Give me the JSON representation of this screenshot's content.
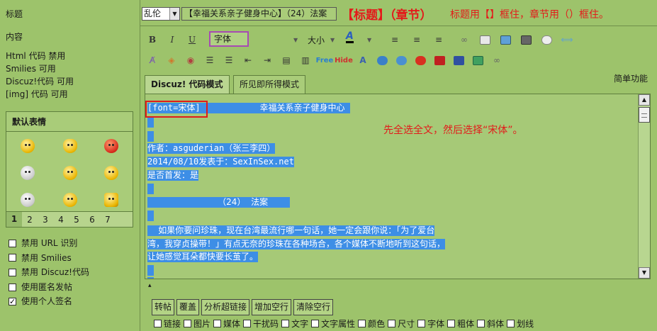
{
  "left": {
    "title_label": "标题",
    "content_label": "内容",
    "rules": [
      "Html 代码 禁用",
      "Smilies 可用",
      "Discuz!代码 可用",
      "[img] 代码 可用"
    ],
    "smilies_title": "默认表情",
    "pages": [
      "1",
      "2",
      "3",
      "4",
      "5",
      "6",
      "7"
    ],
    "options": [
      {
        "label": "禁用 URL 识别",
        "checked": false
      },
      {
        "label": "禁用 Smilies",
        "checked": false
      },
      {
        "label": "禁用 Discuz!代码",
        "checked": false
      },
      {
        "label": "使用匿名发帖",
        "checked": false
      },
      {
        "label": "使用个人签名",
        "checked": true
      }
    ]
  },
  "header": {
    "category": "乱伦",
    "title_value": "【幸福关系亲子健身中心】（24）法案",
    "annotation_big": "【标题】（章节）",
    "annotation_small": "标题用【】框住，章节用（）框住。"
  },
  "toolbar": {
    "font_label": "字体",
    "size_label": "大小",
    "simple_mode": "简单功能"
  },
  "tabs": [
    {
      "label": "Discuz! 代码模式",
      "active": true
    },
    {
      "label": "所见即所得模式",
      "active": false
    }
  ],
  "editor": {
    "annotation": "先全选全文，然后选择“宋体”。",
    "lines": [
      {
        "prefix": "[font=宋体]",
        "text": "                      幸福关系亲子健身中心  "
      },
      {
        "prefix": "",
        "text": " "
      },
      {
        "prefix": "",
        "text": " "
      },
      {
        "prefix": "",
        "text": "作者：asguderian（张三李四）"
      },
      {
        "prefix": "",
        "text": "2014/08/10发表于：SexInSex.net"
      },
      {
        "prefix": "",
        "text": "是否首发：是"
      },
      {
        "prefix": "",
        "text": " "
      },
      {
        "prefix": "",
        "text": "                          （24）  法案        "
      },
      {
        "prefix": "",
        "text": " "
      },
      {
        "prefix": "",
        "text": "    如果你要问珍珠，现在台湾最流行哪一句话，她一定会跟你说：「为了爱台"
      },
      {
        "prefix": "",
        "text": "湾，我穿贞操带！」有点无奈的珍珠在各种场合，各个媒体不断地听到这句话，"
      },
      {
        "prefix": "",
        "text": "让她感觉耳朵都快要长茧了。"
      },
      {
        "prefix": "",
        "text": " "
      },
      {
        "prefix": "",
        "text": " "
      }
    ]
  },
  "bottom": {
    "buttons": [
      "转帖",
      "覆盖",
      "分析超链接",
      "增加空行",
      "清除空行"
    ],
    "checks": [
      "链接",
      "图片",
      "媒体",
      "干扰码",
      "文字",
      "文字属性",
      "颜色",
      "尺寸",
      "字体",
      "粗体",
      "斜体",
      "划线"
    ]
  }
}
